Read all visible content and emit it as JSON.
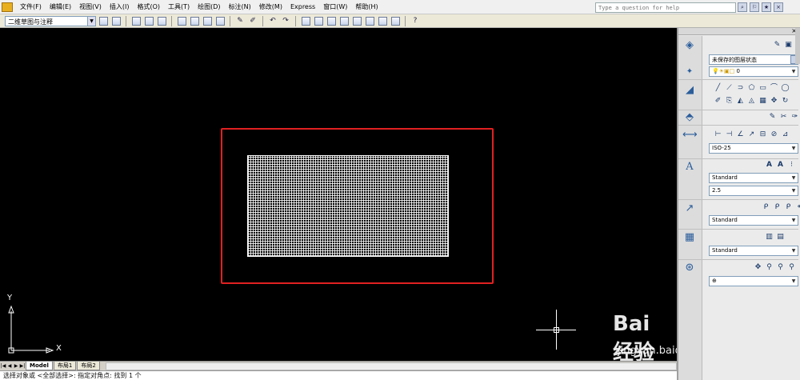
{
  "menu": [
    "文件(F)",
    "编辑(E)",
    "视图(V)",
    "插入(I)",
    "格式(O)",
    "工具(T)",
    "绘图(D)",
    "标注(N)",
    "修改(M)",
    "Express",
    "窗口(W)",
    "帮助(H)"
  ],
  "help": {
    "placeholder": "Type a question for help"
  },
  "toolbar": {
    "workspace": "二维草图与注释"
  },
  "panel": {
    "layer_state": "未保存的图层状态",
    "layer_name": "0",
    "dim_style": "ISO-25",
    "text_style": "Standard",
    "text_height": "2.5",
    "multileader_style": "Standard",
    "table_style": "Standard"
  },
  "tabs": [
    "Model",
    "布局1",
    "布局2"
  ],
  "command_line": "选择对象或 <全部选择>: 指定对角点: 找到 1 个",
  "ucs": {
    "x_label": "X",
    "y_label": "Y"
  },
  "watermark": {
    "brand": "Bai  经验",
    "url": "jingyan.baidu.com"
  },
  "colors": {
    "canvas": "#000000",
    "highlight": "#e02020",
    "grid": "#ffffff"
  }
}
